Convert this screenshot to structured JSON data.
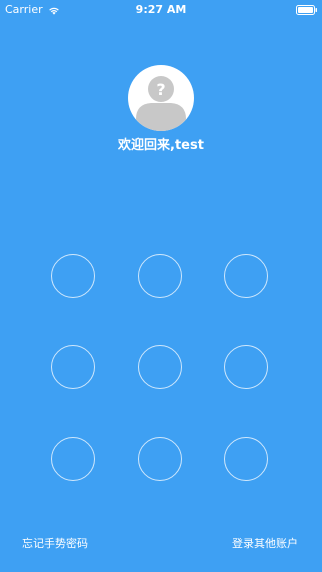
{
  "status_bar": {
    "carrier": "Carrier",
    "time": "9:27 AM",
    "wifi_icon": "wifi-icon",
    "battery_icon": "battery-icon"
  },
  "profile": {
    "avatar_icon": "default-avatar-question-icon",
    "welcome_text": "欢迎回来,test"
  },
  "gesture_pad": {
    "points": [
      "1",
      "2",
      "3",
      "4",
      "5",
      "6",
      "7",
      "8",
      "9"
    ]
  },
  "footer": {
    "forgot_label": "忘记手势密码",
    "other_account_label": "登录其他账户"
  },
  "colors": {
    "background": "#3ea0f3",
    "text": "#ffffff",
    "ring": "#d6ebfd",
    "avatar_bg": "#ffffff",
    "avatar_figure": "#c8c8c8"
  }
}
